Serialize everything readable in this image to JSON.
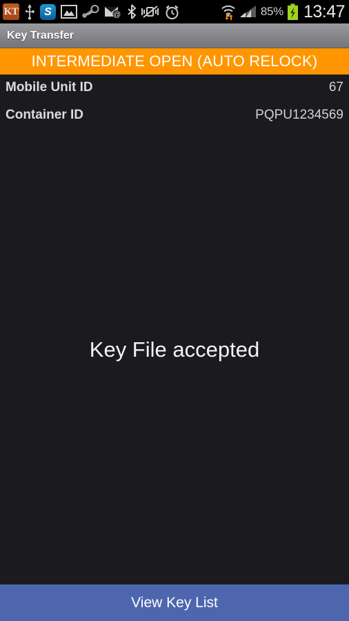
{
  "status_bar": {
    "left_icons": [
      {
        "name": "key-transfer-app-icon",
        "glyph": "KT"
      },
      {
        "name": "usb-icon",
        "glyph": "usb"
      },
      {
        "name": "skype-icon",
        "glyph": "S"
      },
      {
        "name": "gallery-image-icon",
        "glyph": "image"
      },
      {
        "name": "steam-icon",
        "glyph": "steam"
      },
      {
        "name": "email-icon",
        "glyph": "envelope-at"
      },
      {
        "name": "bluetooth-icon",
        "glyph": "bluetooth"
      },
      {
        "name": "vibrate-mute-icon",
        "glyph": "vibrate"
      },
      {
        "name": "alarm-clock-icon",
        "glyph": "alarm"
      }
    ],
    "wifi_icon": "wifi-transfer-icon",
    "signal_icon": "cellular-signal-icon",
    "battery_percent": "85%",
    "battery_icon": "battery-charging-icon",
    "clock": "13:47"
  },
  "title_bar": {
    "title": "Key Transfer"
  },
  "banner": {
    "text": "INTERMEDIATE OPEN (AUTO RELOCK)",
    "color": "#ff9500"
  },
  "info": {
    "rows": [
      {
        "label": "Mobile Unit ID",
        "value": "67"
      },
      {
        "label": "Container ID",
        "value": "PQPU1234569"
      }
    ]
  },
  "main": {
    "message": "Key File accepted"
  },
  "bottom_button": {
    "label": "View Key List",
    "color": "#4d66ae"
  }
}
